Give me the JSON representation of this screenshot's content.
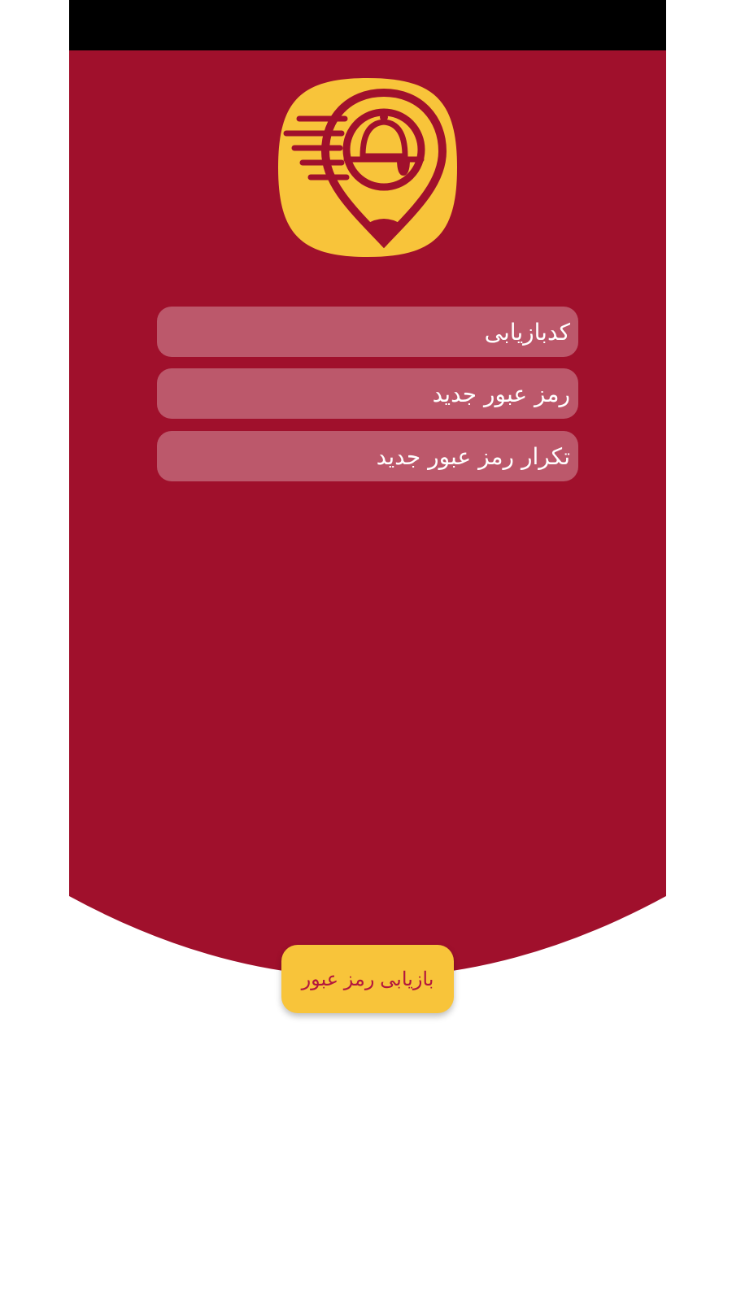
{
  "colors": {
    "status_bar": "#000000",
    "panel_red": "#a0102c",
    "logo_yellow": "#f8c43a",
    "field_bg": "rgba(255,255,255,0.30)",
    "field_text": "#ffffff",
    "button_bg": "#f8c43a",
    "button_text": "#b3163d"
  },
  "logo": {
    "icon": "food-delivery-location-pin-icon"
  },
  "form": {
    "recovery_code_placeholder": "کدبازیابی",
    "new_password_placeholder": "رمز عبور جدید",
    "repeat_password_placeholder": "تکرار رمز عبور جدید"
  },
  "submit": {
    "label": "بازیابی رمز عبور"
  }
}
